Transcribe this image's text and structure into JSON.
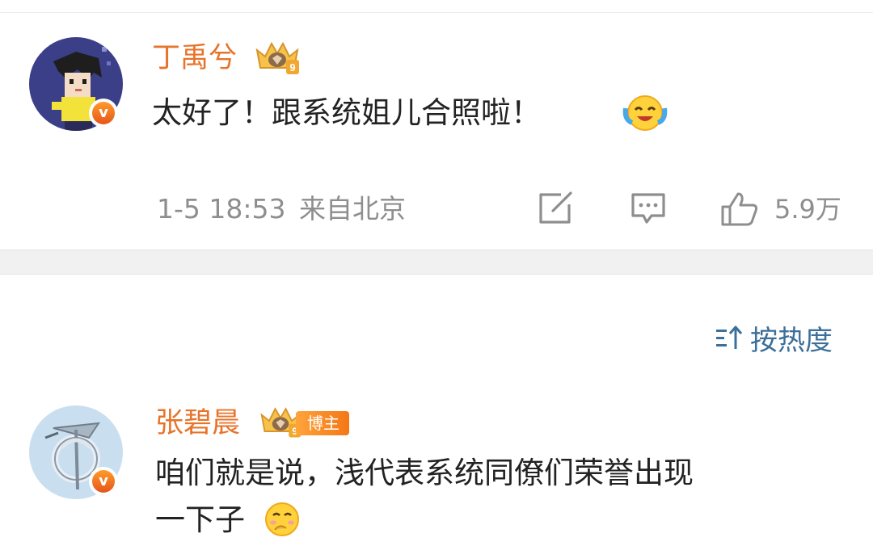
{
  "comments": [
    {
      "username": "丁禹兮",
      "content": "太好了！跟系统姐儿合照啦！",
      "verified_mark": "v",
      "avatar_icon": "pixel-art-boy-avatar",
      "level_badge": "crown-level-9",
      "emoji": "laughing-tears-emoji",
      "timestamp": "1-5 18:53",
      "location": "来自北京",
      "like_count": "5.9万"
    },
    {
      "username": "张碧晨",
      "badge_label": "博主",
      "verified_mark": "v",
      "avatar_icon": "silver-ornament-avatar",
      "level_badge": "crown-level-9",
      "content_line1": "咱们就是说，浅代表系统同僚们荣誉出现",
      "content_line2": "一下子",
      "emoji": "shy-smile-emoji"
    }
  ],
  "sort": {
    "label": "按热度",
    "icon": "sort-icon"
  },
  "colors": {
    "username": "#e8732a",
    "meta": "#8e8e8e",
    "sort": "#3c6f99",
    "badge": "#f47617"
  }
}
